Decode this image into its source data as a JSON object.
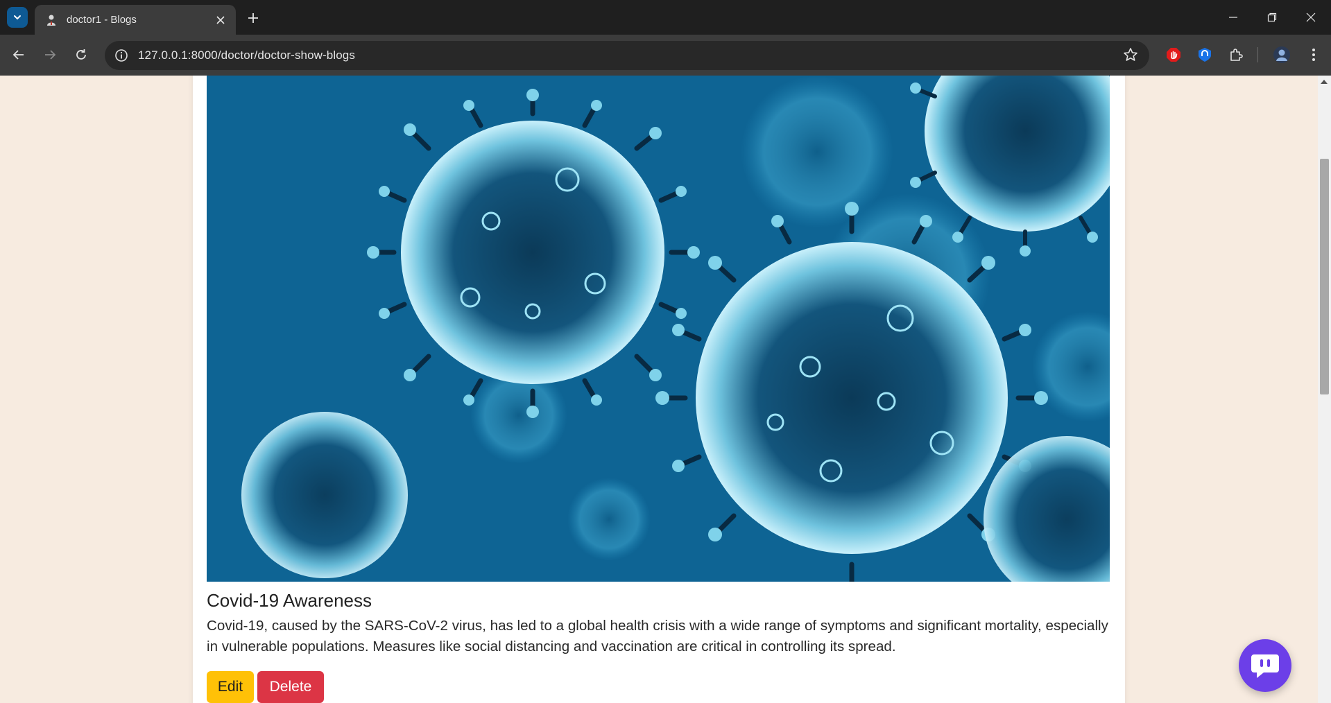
{
  "browser": {
    "tab_title": "doctor1 - Blogs",
    "url": "127.0.0.1:8000/doctor/doctor-show-blogs"
  },
  "blog": {
    "title": "Covid-19 Awareness",
    "body": "Covid-19, caused by the SARS-CoV-2 virus, has led to a global health crisis with a wide range of symptoms and significant mortality, especially in vulnerable populations. Measures like social distancing and vaccination are critical in controlling its spread.",
    "image_subject": "coronavirus particles illustration",
    "edit_label": "Edit",
    "delete_label": "Delete"
  },
  "colors": {
    "page_background": "#f7ebe0",
    "edit_button": "#ffc107",
    "delete_button": "#dc3545",
    "chat_button": "#6c3fe8"
  },
  "icons": {
    "chat": "chat-bubble-icon",
    "star": "bookmark-star-icon",
    "info": "site-info-icon"
  }
}
